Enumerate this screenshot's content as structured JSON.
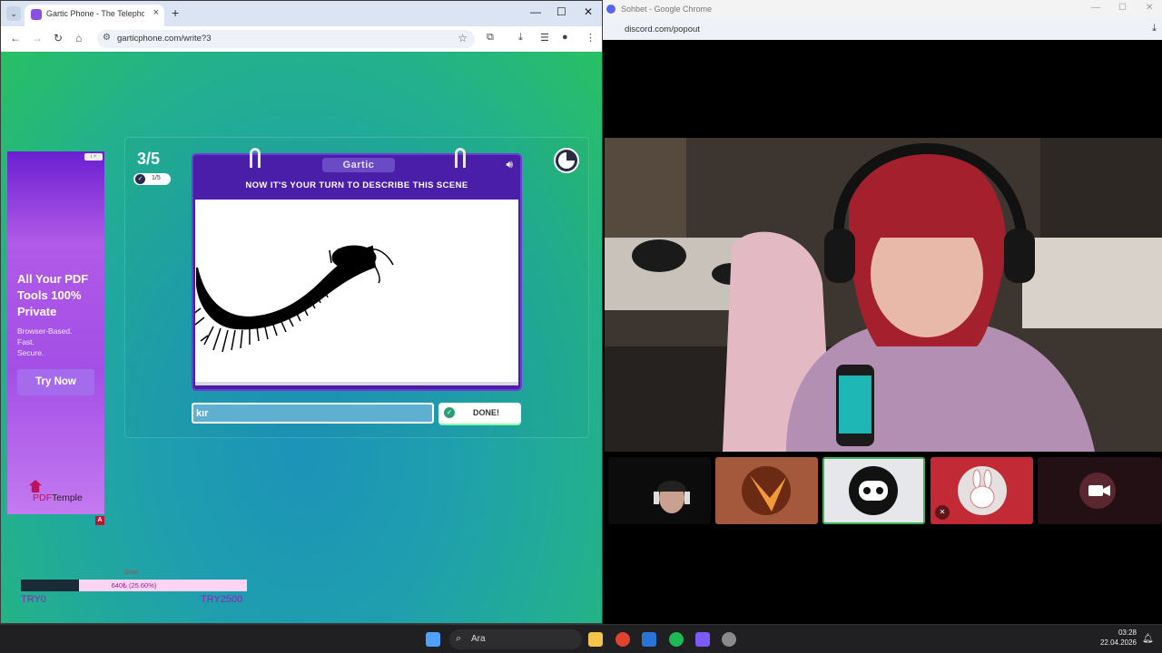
{
  "left_browser": {
    "tab_title": "Gartic Phone - The Telephone G",
    "url": "garticphone.com/write?3",
    "new_tab_symbol": "+",
    "close_symbol": "×"
  },
  "ad": {
    "tag": "i ×",
    "headline": "All Your PDF Tools 100% Private",
    "subtext_1": "Browser-Based.",
    "subtext_2": "Fast.",
    "subtext_3": "Secure.",
    "cta": "Try Now",
    "brand_part1": "PDF",
    "brand_part2": "Temple",
    "badge": "A"
  },
  "game": {
    "round": "3/5",
    "submitted": "1/5",
    "logo": "Gartic",
    "prompt": "NOW IT'S YOUR TURN TO DESCRIBE THIS SCENE",
    "answer_value": "kır",
    "done_label": "DONE!"
  },
  "goal": {
    "caption": "Goal",
    "label": "640₺ (25.60%)",
    "progress_fraction": 0.256,
    "min_label": "TRY0",
    "max_label": "TRY2500"
  },
  "right_browser": {
    "title": "Sohbet - Google Chrome",
    "url": "discord.com/popout"
  },
  "taskbar": {
    "search_placeholder": "Ara",
    "time": "03:28",
    "date": "22.04.2026"
  }
}
